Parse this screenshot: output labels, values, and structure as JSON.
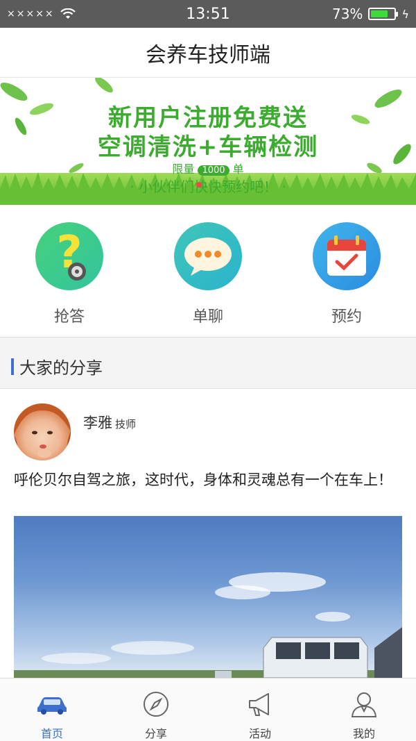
{
  "status_bar": {
    "signal": "×××××",
    "time": "13:51",
    "battery_percent": "73%",
    "battery_level": 0.73
  },
  "header": {
    "title": "会养车技师端"
  },
  "banner": {
    "line1": "新用户注册免费送",
    "line2": "空调清洗+车辆检测",
    "limit_prefix": "限量",
    "limit_count": "1000",
    "limit_suffix": "单",
    "line4": "· 小伙伴们快快预约吧！ ·"
  },
  "actions": [
    {
      "label": "抢答",
      "icon": "question-icon"
    },
    {
      "label": "单聊",
      "icon": "chat-icon"
    },
    {
      "label": "预约",
      "icon": "calendar-icon"
    }
  ],
  "section": {
    "title": "大家的分享"
  },
  "post": {
    "author": "李雅",
    "role": "技师",
    "text": "呼伦贝尔自驾之旅，这时代，身体和灵魂总有一个在车上！"
  },
  "tabbar": {
    "tabs": [
      {
        "label": "首页",
        "icon": "car-icon",
        "active": true
      },
      {
        "label": "分享",
        "icon": "compass-icon",
        "active": false
      },
      {
        "label": "活动",
        "icon": "megaphone-icon",
        "active": false
      },
      {
        "label": "我的",
        "icon": "user-icon",
        "active": false
      }
    ]
  },
  "colors": {
    "accent": "#3d6fd0",
    "banner_green": "#3cab2f",
    "status_bar": "#5b5b5b"
  }
}
